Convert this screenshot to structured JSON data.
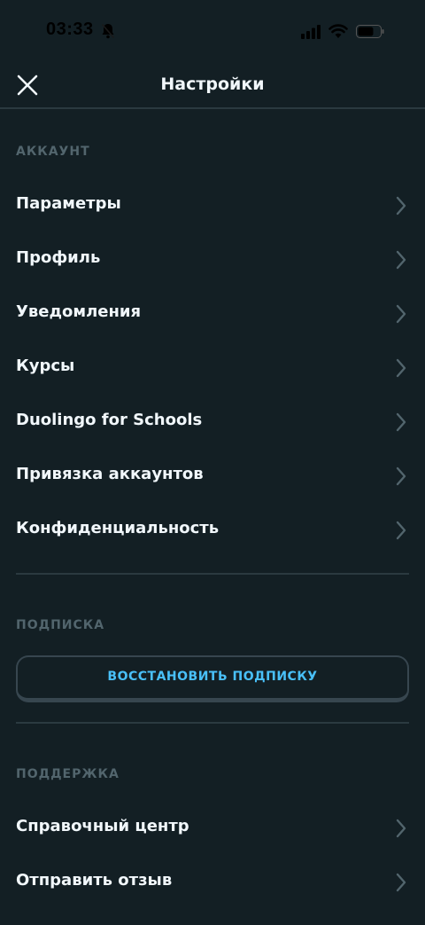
{
  "status_bar": {
    "time": "03:33",
    "icons": [
      "bell-slash-icon",
      "cellular-signal-icon",
      "wifi-icon",
      "battery-icon"
    ]
  },
  "header": {
    "title": "Настройки",
    "close_icon": "close-icon"
  },
  "account": {
    "section_label": "АККАУНТ",
    "items": [
      {
        "label": "Параметры"
      },
      {
        "label": "Профиль"
      },
      {
        "label": "Уведомления"
      },
      {
        "label": "Курсы"
      },
      {
        "label": "Duolingo for Schools"
      },
      {
        "label": "Привязка аккаунтов"
      },
      {
        "label": "Конфиденциальность"
      }
    ]
  },
  "subscription": {
    "section_label": "ПОДПИСКА",
    "restore_button_label": "ВОССТАНОВИТЬ ПОДПИСКУ"
  },
  "support": {
    "section_label": "ПОДДЕРЖКА",
    "items": [
      {
        "label": "Справочный центр"
      },
      {
        "label": "Отправить отзыв"
      }
    ]
  },
  "colors": {
    "background": "#131f24",
    "text": "#f1f7fb",
    "section_label": "#52656d",
    "divider": "#2b3a40",
    "accent": "#49c0f8"
  }
}
